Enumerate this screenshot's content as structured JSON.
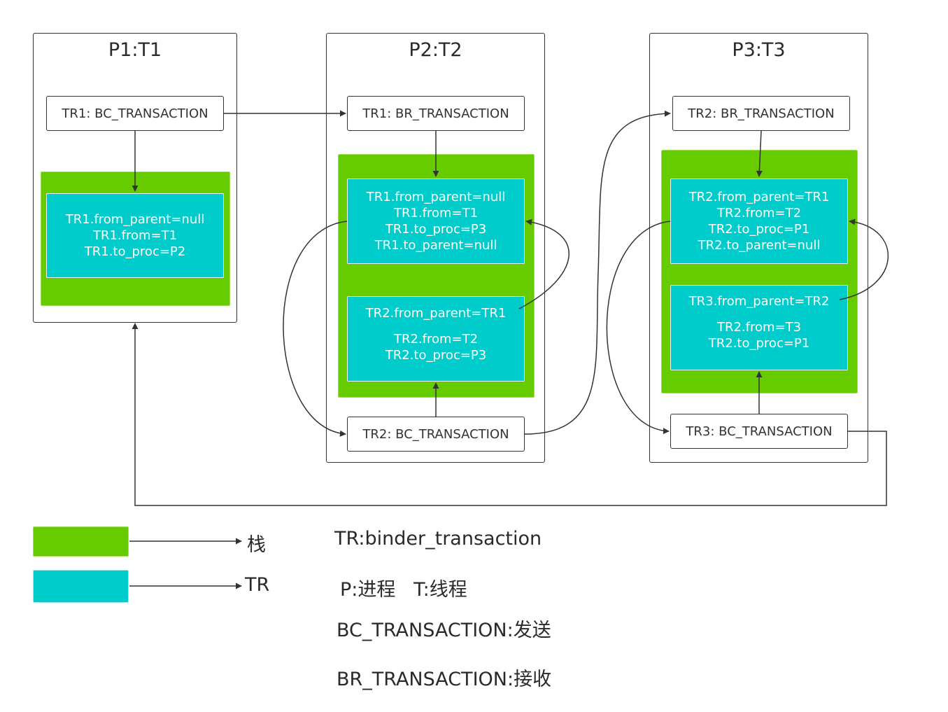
{
  "processes": [
    {
      "title": "P1:T1",
      "top_box": "TR1: BC_TRANSACTION",
      "stack_trs": [
        {
          "lines": [
            "TR1.from_parent=null",
            "TR1.from=T1",
            "TR1.to_proc=P2"
          ]
        }
      ]
    },
    {
      "title": "P2:T2",
      "top_box": "TR1: BR_TRANSACTION",
      "stack_trs": [
        {
          "lines": [
            "TR1.from_parent=null",
            "TR1.from=T1",
            "TR1.to_proc=P3",
            "TR1.to_parent=null"
          ]
        },
        {
          "lines": [
            "TR2.from_parent=TR1",
            "",
            "TR2.from=T2",
            "TR2.to_proc=P3"
          ]
        }
      ],
      "bottom_box": "TR2: BC_TRANSACTION"
    },
    {
      "title": "P3:T3",
      "top_box": "TR2: BR_TRANSACTION",
      "stack_trs": [
        {
          "lines": [
            "TR2.from_parent=TR1",
            "TR2.from=T2",
            "TR2.to_proc=P1",
            "TR2.to_parent=null"
          ]
        },
        {
          "lines": [
            "TR3.from_parent=TR2",
            "",
            "TR2.from=T3",
            "TR2.to_proc=P1"
          ]
        }
      ],
      "bottom_box": "TR3: BC_TRANSACTION"
    }
  ],
  "legend": {
    "stack_label": "栈",
    "tr_label": "TR",
    "notes": [
      "TR:binder_transaction",
      "P:进程   T:线程",
      "BC_TRANSACTION:发送",
      "BR_TRANSACTION:接收"
    ]
  },
  "colors": {
    "stack": "#66cc00",
    "tr": "#00cccc",
    "stroke": "#333333"
  }
}
